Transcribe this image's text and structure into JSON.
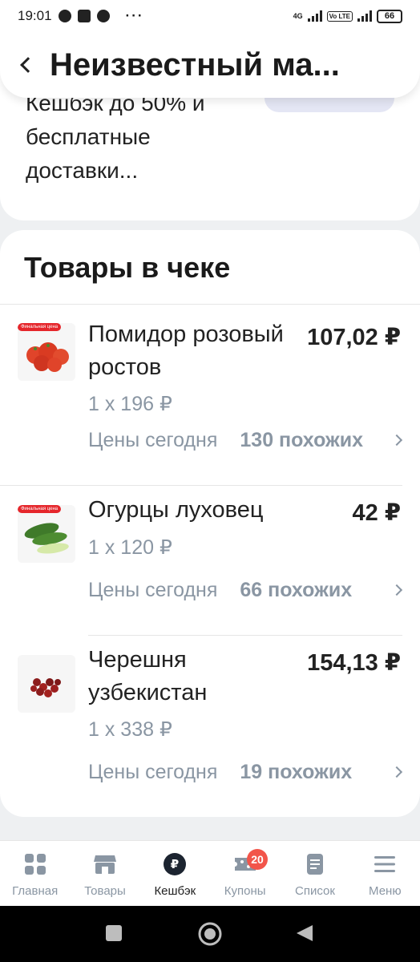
{
  "status_bar": {
    "time": "19:01",
    "dots": "···",
    "net_type": "4G",
    "volte": "Vo LTE",
    "battery": "66"
  },
  "header": {
    "title": "Неизвестный ма..."
  },
  "promo": {
    "text": "Кешбэк до 50% и бесплатные доставки..."
  },
  "receipt": {
    "section_title": "Товары в чеке",
    "badge_label": "Финальная цена",
    "prices_label": "Цены сегодня",
    "items": [
      {
        "name": "Помидор розовый ростов",
        "price": "107,02 ₽",
        "qty": "1 x 196 ₽",
        "similar": "130 похожих"
      },
      {
        "name": "Огурцы луховец",
        "price": "42 ₽",
        "qty": "1 x 120 ₽",
        "similar": "66 похожих"
      },
      {
        "name": "Черешня узбекистан",
        "price": "154,13 ₽",
        "qty": "1 x 338 ₽",
        "similar": "19 похожих"
      }
    ]
  },
  "bottom_nav": {
    "items": [
      {
        "label": "Главная",
        "icon": "home-grid-icon"
      },
      {
        "label": "Товары",
        "icon": "shop-icon"
      },
      {
        "label": "Кешбэк",
        "icon": "ruble-coin-icon",
        "active": true
      },
      {
        "label": "Купоны",
        "icon": "coupon-icon",
        "badge": "20"
      },
      {
        "label": "Список",
        "icon": "list-icon"
      },
      {
        "label": "Меню",
        "icon": "menu-icon"
      }
    ]
  },
  "colors": {
    "accent_badge": "#f2554a",
    "muted_text": "#8a96a3",
    "label_red": "#e5262b"
  }
}
